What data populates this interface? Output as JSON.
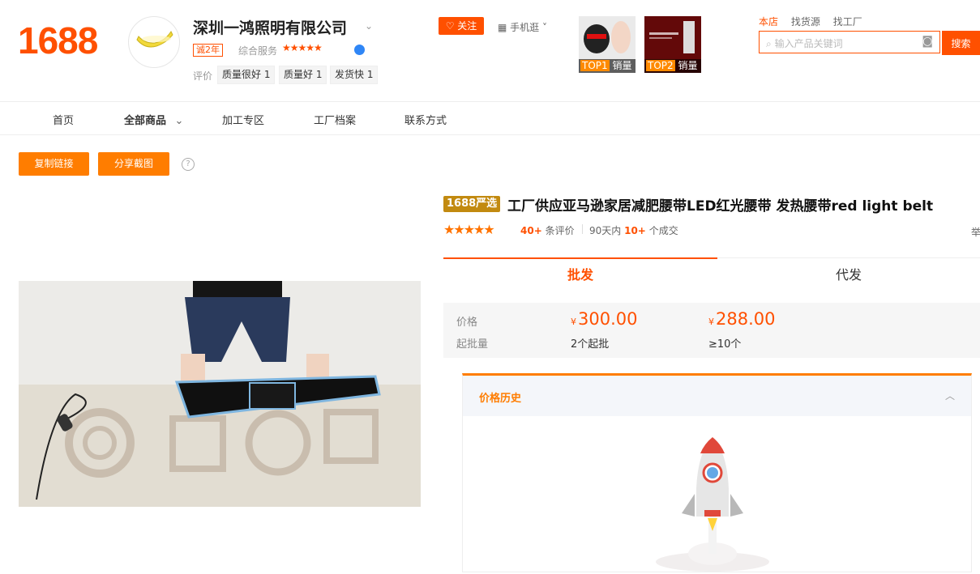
{
  "header": {
    "logo": "1688",
    "store_name": "深圳一鸿照明有限公司",
    "years_badge": "诚2年",
    "service_label": "综合服务",
    "service_stars": "★★★★★",
    "review_label": "评价",
    "tags": [
      "质量很好 1",
      "质量好 1",
      "发货快 1"
    ],
    "follow_label": "关注",
    "mobile_label": "手机逛",
    "top_products": [
      {
        "rank": "TOP1",
        "label": "销量"
      },
      {
        "rank": "TOP2",
        "label": "销量"
      }
    ],
    "search_tabs": [
      "本店",
      "找货源",
      "找工厂"
    ],
    "search_placeholder": "输入产品关键词",
    "search_button": "搜索"
  },
  "nav": {
    "items": [
      "首页",
      "全部商品",
      "加工专区",
      "工厂档案",
      "联系方式"
    ]
  },
  "actions": {
    "copy_link": "复制链接",
    "share_shot": "分享截图"
  },
  "product": {
    "badge": "1688严选",
    "title": "工厂供应亚马逊家居减肥腰带LED红光腰带 发热腰带red light belt",
    "stars": "★★★★★",
    "review_count": "40+",
    "review_suffix": "条评价",
    "deals_prefix": "90天内",
    "deals_count": "10+",
    "deals_suffix": "个成交",
    "side_char": "举"
  },
  "tabs": {
    "wholesale": "批发",
    "dropship": "代发"
  },
  "pricing": {
    "price_label": "价格",
    "moq_label": "起批量",
    "currency": "¥",
    "tiers": [
      {
        "price": "300.00",
        "moq": "2个起批"
      },
      {
        "price": "288.00",
        "moq": "≥10个"
      }
    ]
  },
  "history": {
    "title": "价格历史"
  },
  "colors": {
    "brand": "#ff5000",
    "accent": "#ff7d00"
  }
}
